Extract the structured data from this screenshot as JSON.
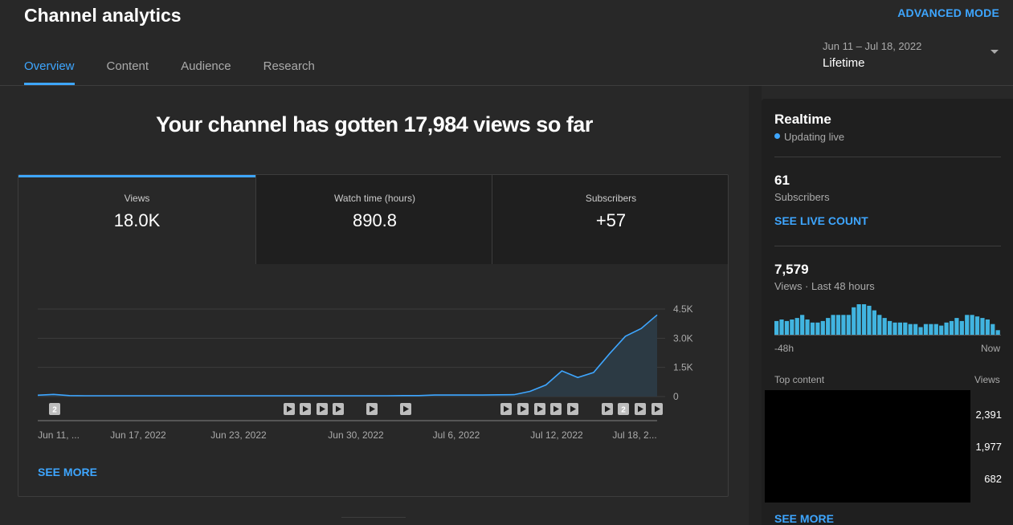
{
  "header": {
    "title": "Channel analytics",
    "advanced_mode": "ADVANCED MODE"
  },
  "tabs": [
    {
      "label": "Overview",
      "active": true
    },
    {
      "label": "Content"
    },
    {
      "label": "Audience"
    },
    {
      "label": "Research"
    }
  ],
  "date": {
    "range": "Jun 11 – Jul 18, 2022",
    "preset": "Lifetime"
  },
  "main": {
    "headline": "Your channel has gotten 17,984 views so far",
    "metrics": [
      {
        "label": "Views",
        "value": "18.0K"
      },
      {
        "label": "Watch time (hours)",
        "value": "890.8"
      },
      {
        "label": "Subscribers",
        "value": "+57"
      }
    ],
    "see_more": "SEE MORE"
  },
  "chart_data": {
    "type": "area",
    "series": [
      {
        "values": [
          70,
          110,
          50,
          40,
          40,
          40,
          40,
          40,
          40,
          40,
          40,
          40,
          40,
          40,
          40,
          40,
          40,
          40,
          40,
          40,
          40,
          40,
          40,
          50,
          50,
          80,
          80,
          80,
          80,
          90,
          100,
          270,
          600,
          1320,
          980,
          1240,
          2200,
          3100,
          3500,
          4200
        ]
      }
    ],
    "x_ticks": [
      "Jun 11, ...",
      "Jun 17, 2022",
      "Jun 23, 2022",
      "Jun 30, 2022",
      "Jul 6, 2022",
      "Jul 12, 2022",
      "Jul 18, 2..."
    ],
    "y_ticks": [
      "4.5K",
      "3.0K",
      "1.5K",
      "0"
    ],
    "ylim": [
      0,
      4500
    ],
    "grid": true,
    "line_color": "#3ea6ff",
    "fill_color": "#2c3a44",
    "markers": [
      {
        "kind": "num",
        "label": "2"
      },
      {
        "kind": "play"
      },
      {
        "kind": "play"
      },
      {
        "kind": "play"
      },
      {
        "kind": "play"
      },
      {
        "kind": "play"
      },
      {
        "kind": "play"
      },
      {
        "kind": "play"
      },
      {
        "kind": "play"
      },
      {
        "kind": "play"
      },
      {
        "kind": "play"
      },
      {
        "kind": "play"
      },
      {
        "kind": "play"
      },
      {
        "kind": "num",
        "label": "2"
      },
      {
        "kind": "play"
      },
      {
        "kind": "play"
      }
    ]
  },
  "realtime": {
    "title": "Realtime",
    "status": "Updating live",
    "subscribers_value": "61",
    "subscribers_label": "Subscribers",
    "live_count": "SEE LIVE COUNT",
    "views_value": "7,579",
    "views_label": "Views · Last 48 hours",
    "bars_label_left": "-48h",
    "bars_label_right": "Now",
    "hourly_views": [
      45,
      50,
      45,
      50,
      55,
      65,
      50,
      40,
      40,
      45,
      55,
      65,
      65,
      65,
      65,
      90,
      100,
      100,
      95,
      80,
      65,
      55,
      45,
      40,
      40,
      40,
      35,
      35,
      25,
      35,
      35,
      35,
      30,
      40,
      45,
      55,
      45,
      65,
      65,
      60,
      55,
      50,
      35,
      15
    ],
    "top_content_label": "Top content",
    "top_views_label": "Views",
    "top_content_views": [
      "2,391",
      "1,977",
      "682"
    ],
    "see_more": "SEE MORE"
  }
}
